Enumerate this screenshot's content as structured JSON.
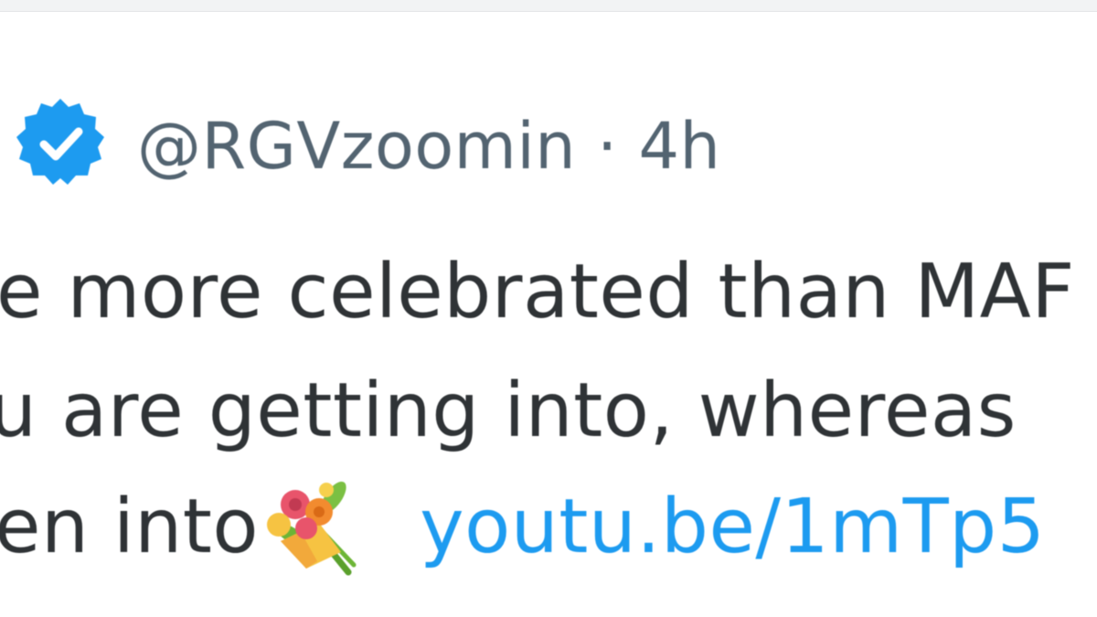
{
  "tweet": {
    "handle": "@RGVzoomin",
    "separator": "·",
    "time": "4h",
    "lines": [
      "e more celebrated than MAF",
      "u are getting into,  whereas",
      "en into"
    ],
    "emoji": "bouquet-emoji",
    "link_text": "youtu.be/1mTp5"
  },
  "colors": {
    "verified_badge": "#1d9bf0",
    "link": "#1d9bf0",
    "secondary_text": "#536471",
    "primary_text": "#2f3336"
  }
}
